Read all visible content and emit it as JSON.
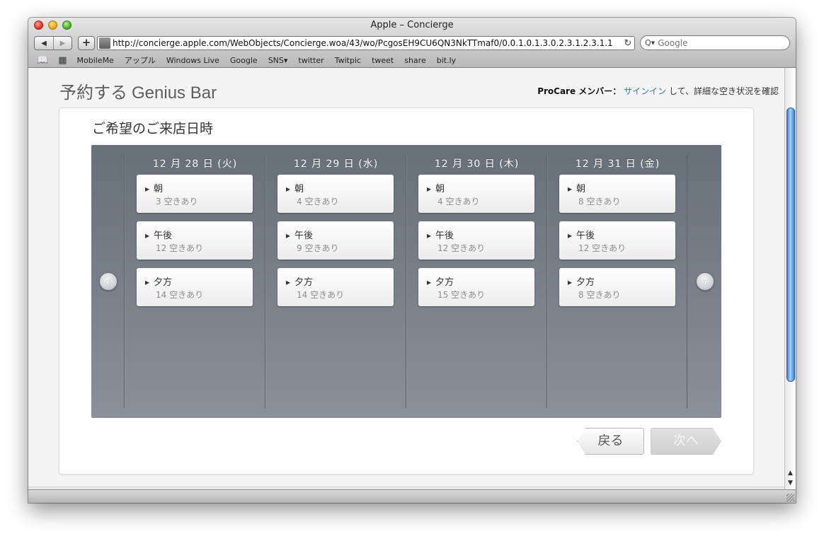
{
  "window": {
    "title": "Apple – Concierge"
  },
  "toolbar": {
    "back_icon": "◀",
    "forward_icon": "▶",
    "add_icon": "+",
    "url": "http://concierge.apple.com/WebObjects/Concierge.woa/43/wo/PcgosEH9CU6QN3NkTTmaf0/0.0.1.0.1.3.0.2.3.1.2.3.1.1",
    "reload_icon": "↻",
    "search_placeholder": "Google",
    "search_icon": "Q▾"
  },
  "bookmarks": {
    "book_icon": "📖",
    "grid_icon": "▦",
    "items": [
      "MobileMe",
      "アップル",
      "Windows Live",
      "Google",
      "SNS▾",
      "twitter",
      "Twitpic",
      "tweet",
      "share",
      "bit.ly"
    ]
  },
  "header": {
    "title": "予約する",
    "subtitle": "Genius Bar",
    "procare_label": "ProCare メンバー：",
    "signin_link": "サインイン",
    "procare_suffix": " して、詳細な空き状況を確認"
  },
  "card": {
    "heading": "ご希望のご来店日時"
  },
  "days": [
    {
      "date": "12 月 28 日 (火)",
      "slots": [
        {
          "name": "朝",
          "avail": "3 空きあり"
        },
        {
          "name": "午後",
          "avail": "12 空きあり"
        },
        {
          "name": "夕方",
          "avail": "14 空きあり"
        }
      ]
    },
    {
      "date": "12 月 29 日 (水)",
      "slots": [
        {
          "name": "朝",
          "avail": "4 空きあり"
        },
        {
          "name": "午後",
          "avail": "9 空きあり"
        },
        {
          "name": "夕方",
          "avail": "14 空きあり"
        }
      ]
    },
    {
      "date": "12 月 30 日 (木)",
      "slots": [
        {
          "name": "朝",
          "avail": "4 空きあり"
        },
        {
          "name": "午後",
          "avail": "12 空きあり"
        },
        {
          "name": "夕方",
          "avail": "15 空きあり"
        }
      ]
    },
    {
      "date": "12 月 31 日 (金)",
      "slots": [
        {
          "name": "朝",
          "avail": "8 空きあり"
        },
        {
          "name": "午後",
          "avail": "12 空きあり"
        },
        {
          "name": "夕方",
          "avail": "8 空きあり"
        }
      ]
    }
  ],
  "nav": {
    "prev_icon": "‹",
    "next_icon": "›",
    "back_label": "戻る",
    "next_label": "次へ"
  },
  "colors": {
    "link": "#2d72c4",
    "panel_top": "#676f79",
    "panel_bottom": "#8a909a",
    "scroll_thumb": "#3b7ed6"
  }
}
